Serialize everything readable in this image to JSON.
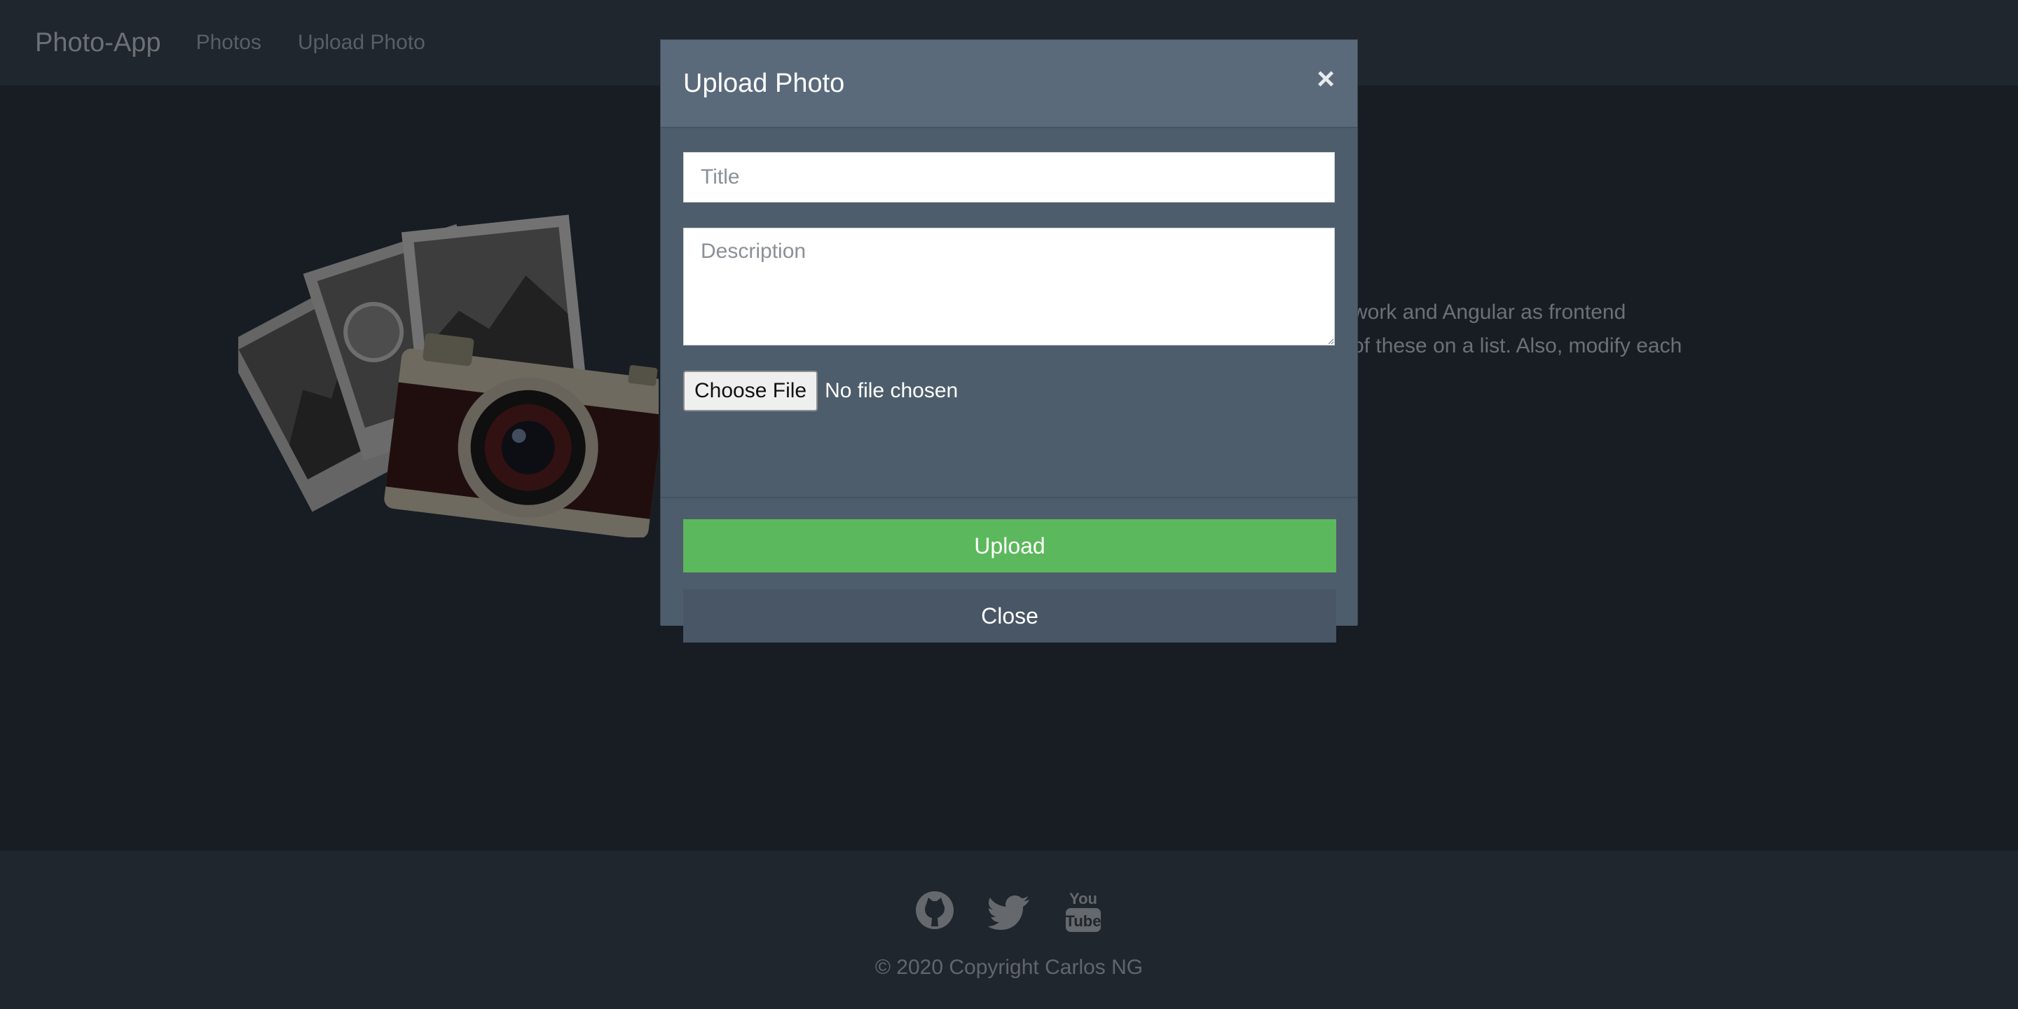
{
  "navbar": {
    "brand": "Photo-App",
    "links": [
      "Photos",
      "Upload Photo"
    ]
  },
  "hero": {
    "lines": [
      "work and Angular as frontend",
      "of these on a list. Also, modify each"
    ]
  },
  "modal": {
    "title": "Upload Photo",
    "close_symbol": "×",
    "title_placeholder": "Title",
    "description_placeholder": "Description",
    "choose_file_label": "Choose File",
    "file_status": "No file chosen",
    "upload_label": "Upload",
    "close_label": "Close"
  },
  "footer": {
    "icons": [
      "github-icon",
      "twitter-icon",
      "youtube-icon"
    ],
    "copyright": "© 2020 Copyright Carlos NG"
  },
  "colors": {
    "upload_button": "#5cb85c",
    "modal_body": "#4e5d6c",
    "navbar": "#3a4553"
  }
}
